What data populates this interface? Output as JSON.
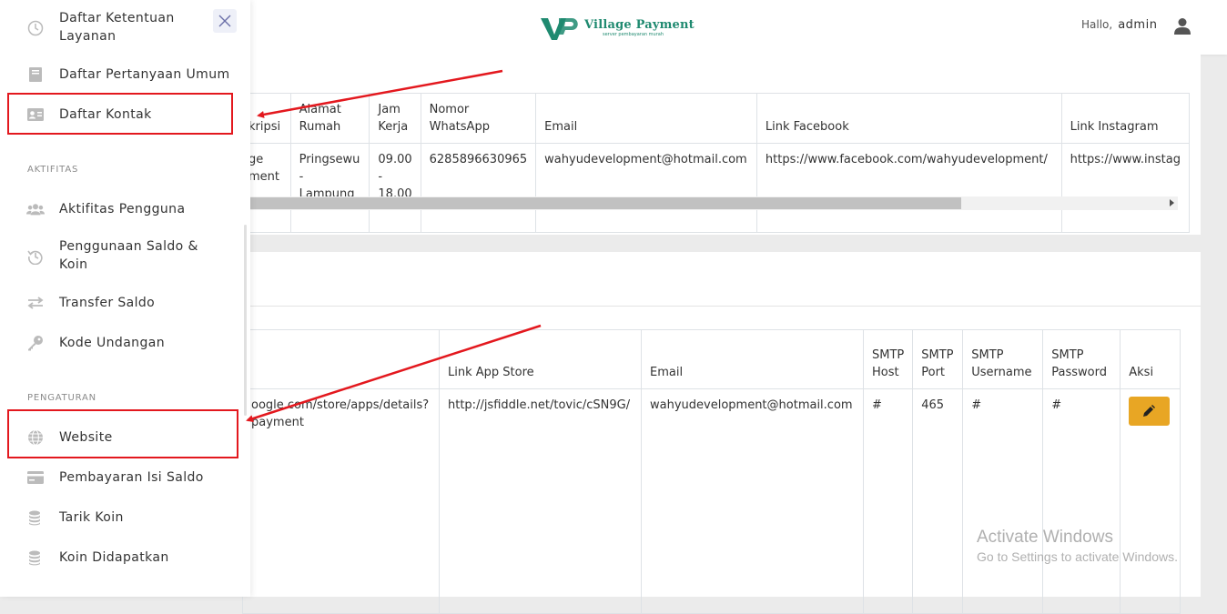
{
  "header": {
    "logo_name": "Village Payment",
    "logo_tagline": "server pembayaran murah",
    "greeting": "Hallo,",
    "username": "admin"
  },
  "sidebar": {
    "items_top": [
      {
        "label": "Daftar Ketentuan Layanan",
        "icon": "clock-icon"
      },
      {
        "label": "Daftar Pertanyaan Umum",
        "icon": "book-icon"
      },
      {
        "label": "Daftar Kontak",
        "icon": "contact-card-icon"
      }
    ],
    "section_aktifitas": "AKTIFITAS",
    "items_aktifitas": [
      {
        "label": "Aktifitas Pengguna",
        "icon": "users-icon"
      },
      {
        "label": "Penggunaan Saldo & Koin",
        "icon": "history-icon"
      },
      {
        "label": "Transfer Saldo",
        "icon": "transfer-icon"
      },
      {
        "label": "Kode Undangan",
        "icon": "key-icon"
      }
    ],
    "section_pengaturan": "PENGATURAN",
    "items_pengaturan": [
      {
        "label": "Website",
        "icon": "globe-icon"
      },
      {
        "label": "Pembayaran Isi Saldo",
        "icon": "credit-card-icon"
      },
      {
        "label": "Tarik Koin",
        "icon": "coins-icon"
      },
      {
        "label": "Koin Didapatkan",
        "icon": "coins-icon"
      }
    ]
  },
  "contact_table": {
    "headers": [
      "kripsi",
      "Alamat Rumah",
      "Jam Kerja",
      "Nomor WhatsApp",
      "Email",
      "Link Facebook",
      "Link Instagram"
    ],
    "row": [
      "ge ment",
      "Pringsewu - Lampung",
      "09.00 - 18.00",
      "6285896630965",
      "wahyudevelopment@hotmail.com",
      "https://www.facebook.com/wahyudevelopment/",
      "https://www.instag"
    ]
  },
  "website_table": {
    "headers": [
      "",
      "Link App Store",
      "Email",
      "SMTP Host",
      "SMTP Port",
      "SMTP Username",
      "SMTP Password",
      "Aksi"
    ],
    "row": [
      "oogle.com/store/apps/details? payment",
      "http://jsfiddle.net/tovic/cSN9G/",
      "wahyudevelopment@hotmail.com",
      "#",
      "465",
      "#",
      "#"
    ]
  },
  "watermark": {
    "line1": "Activate Windows",
    "line2": "Go to Settings to activate Windows."
  },
  "colors": {
    "brand": "#1f8a70",
    "highlight": "#e3181e",
    "edit_button": "#e8a624"
  }
}
